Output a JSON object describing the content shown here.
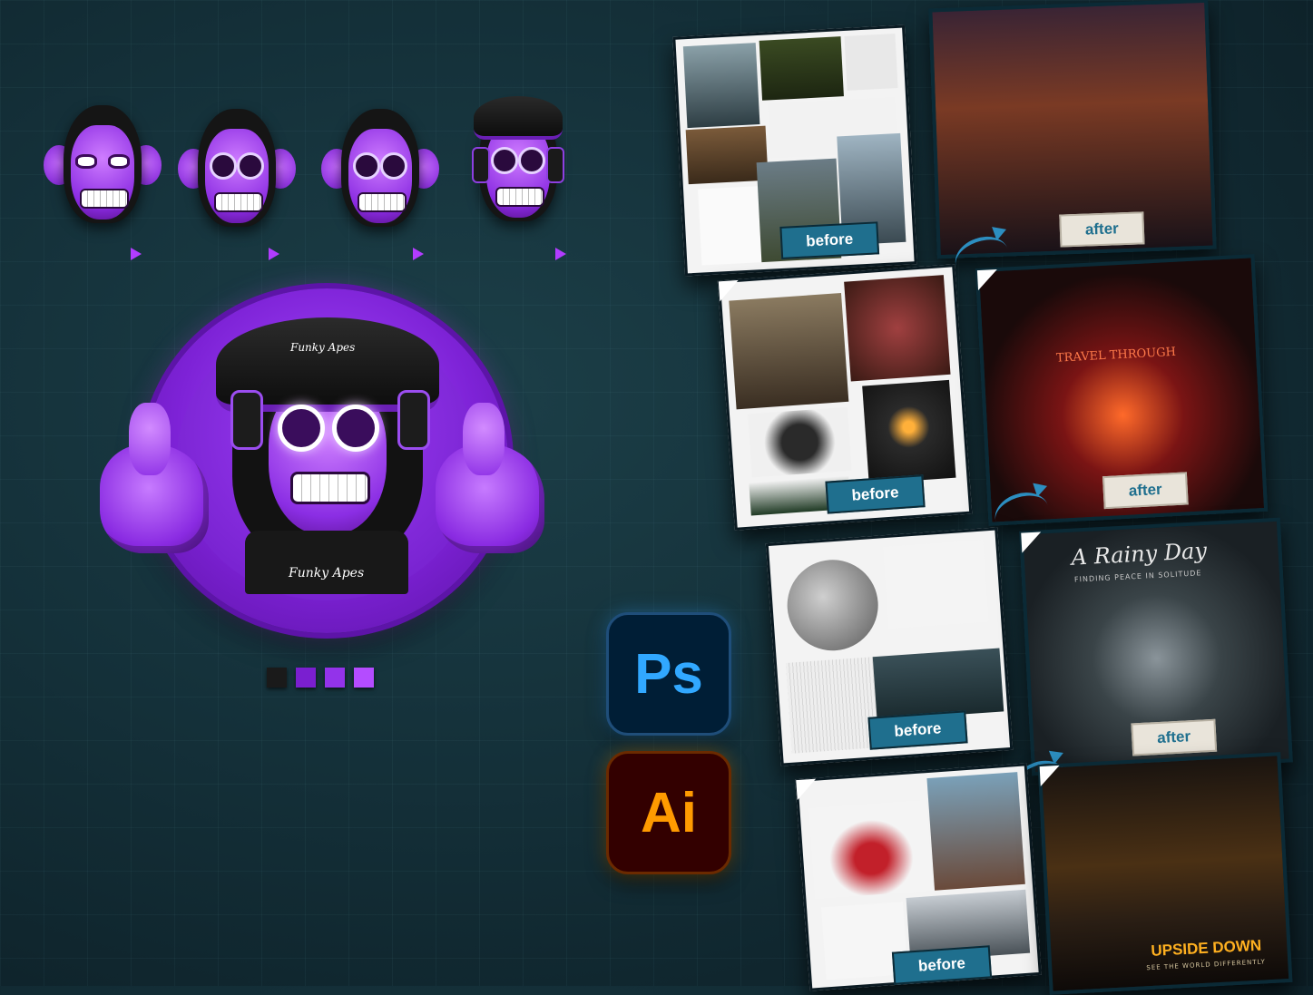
{
  "labels": {
    "before": "before",
    "after": "after"
  },
  "apps": {
    "photoshop": "Ps",
    "illustrator": "Ai"
  },
  "logo": {
    "signature": "Funky Apes"
  },
  "posters": {
    "poster2_title": "TRAVEL THROUGH",
    "poster3_title": "A Rainy Day",
    "poster3_subtitle": "FINDING PEACE IN SOLITUDE",
    "poster4_title": "UPSIDE DOWN",
    "poster4_subtitle": "SEE THE WORLD DIFFERENTLY"
  },
  "palette": {
    "black": "#1a1a1a",
    "purple_dark": "#7a1fd0",
    "purple_mid": "#9333ea",
    "purple_light": "#b44cff"
  },
  "icons": [
    "play-triangle-icon",
    "arrow-curve-icon",
    "page-curl-icon"
  ]
}
